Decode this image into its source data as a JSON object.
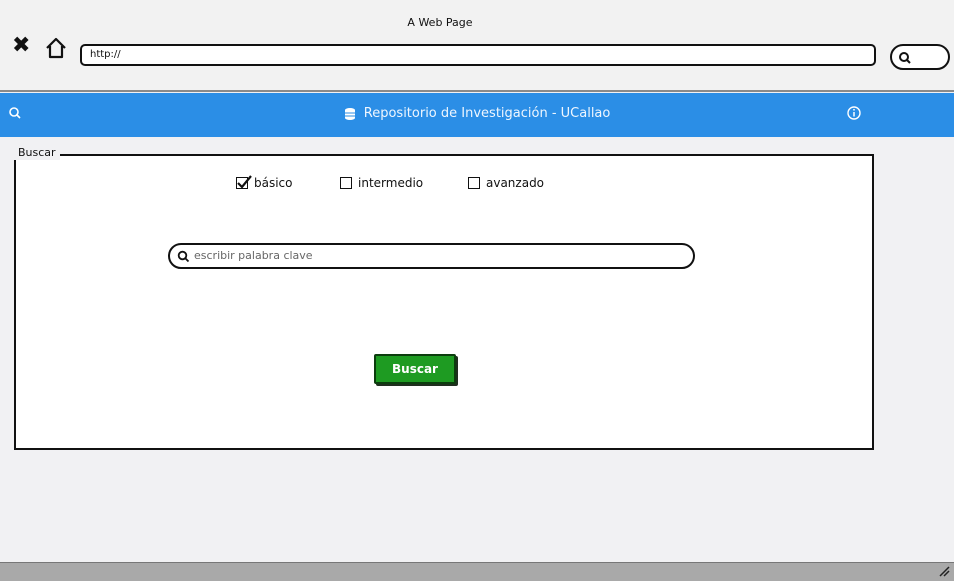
{
  "browser": {
    "window_title": "A Web Page",
    "url": "http://"
  },
  "header": {
    "title": "Repositorio de Investigación - UCallao",
    "color": "#2b8ee6",
    "icons": [
      "search-icon",
      "database-icon",
      "info-icon"
    ]
  },
  "search_panel": {
    "legend": "Buscar",
    "levels": [
      {
        "label": "básico",
        "checked": true
      },
      {
        "label": "intermedio",
        "checked": false
      },
      {
        "label": "avanzado",
        "checked": false
      }
    ],
    "keyword_placeholder": "escribir palabra clave",
    "submit_label": "Buscar",
    "submit_color": "#1e9b22"
  }
}
